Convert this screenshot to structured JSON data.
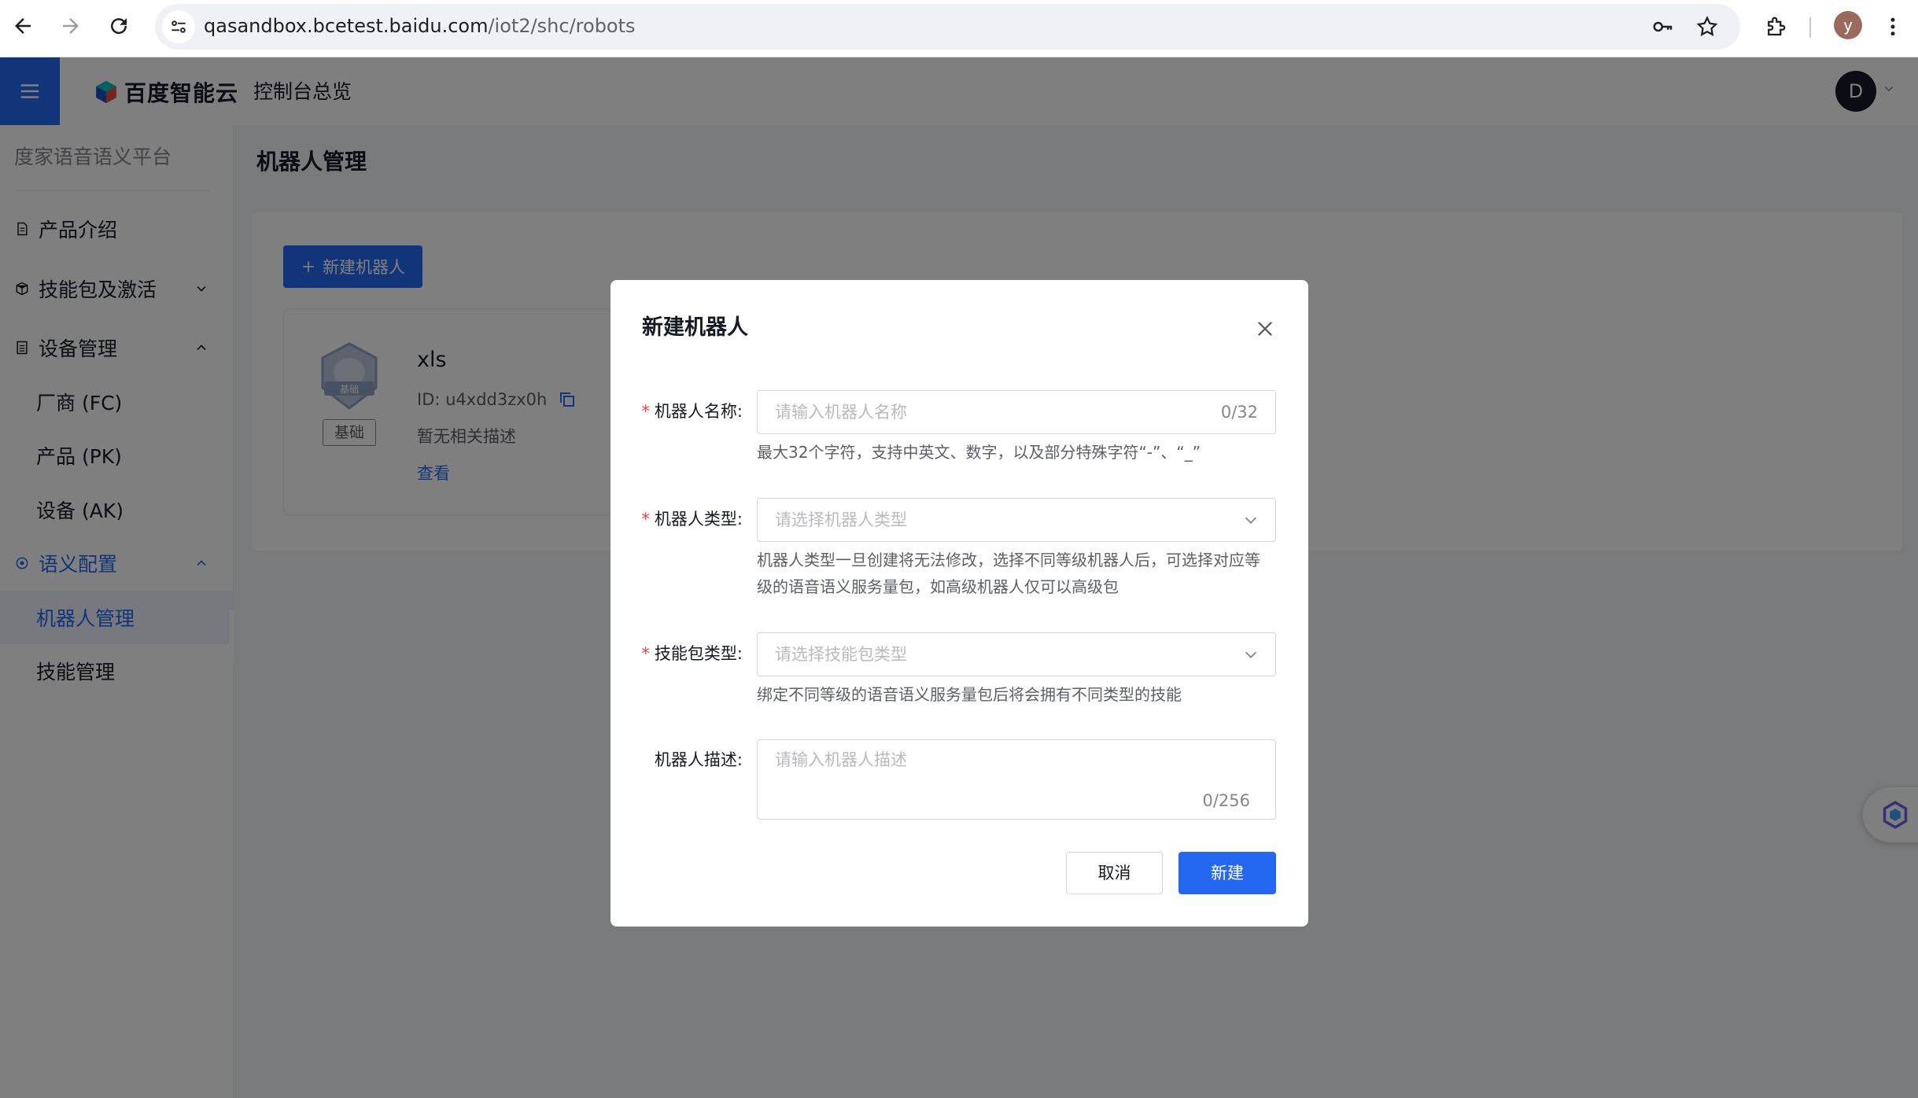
{
  "browser": {
    "url_host": "qasandbox.bcetest.baidu.com",
    "url_path": "/iot2/shc/robots",
    "profile_initial": "y"
  },
  "header": {
    "logo_text": "百度智能云",
    "console_link": "控制台总览",
    "user_initial": "D",
    "accent_color": "#2468f2"
  },
  "sidebar": {
    "title": "度家语音语义平台",
    "items": [
      {
        "label": "产品介绍",
        "icon": "document-icon"
      },
      {
        "label": "技能包及激活",
        "icon": "package-icon",
        "expanded": false
      },
      {
        "label": "设备管理",
        "icon": "device-icon",
        "expanded": true
      },
      {
        "label": "厂商 (FC)"
      },
      {
        "label": "产品 (PK)"
      },
      {
        "label": "设备 (AK)"
      },
      {
        "label": "语义配置",
        "icon": "target-icon",
        "expanded": true
      },
      {
        "label": "机器人管理",
        "active": true
      },
      {
        "label": "技能管理"
      }
    ]
  },
  "main": {
    "page_title": "机器人管理",
    "new_button": "新建机器人",
    "robot_card": {
      "level_tag": "基础",
      "badge_text": "基础",
      "name": "xls",
      "id_text": "ID:  u4xdd3zx0h",
      "description": "暂无相关描述",
      "view_link": "查看"
    }
  },
  "modal": {
    "title": "新建机器人",
    "fields": {
      "name": {
        "label": "机器人名称:",
        "required": true,
        "placeholder": "请输入机器人名称",
        "count": "0/32",
        "hint": "最大32个字符，支持中英文、数字，以及部分特殊字符“-”、“_”"
      },
      "type": {
        "label": "机器人类型:",
        "required": true,
        "placeholder": "请选择机器人类型",
        "hint_line1": "机器人类型一旦创建将无法修改，选择不同等级机器人后，可选择对应等",
        "hint_line2": "级的语音语义服务量包，如高级机器人仅可以高级包"
      },
      "skill": {
        "label": "技能包类型:",
        "required": true,
        "placeholder": "请选择技能包类型",
        "hint": "绑定不同等级的语音语义服务量包后将会拥有不同类型的技能"
      },
      "desc": {
        "label": "机器人描述:",
        "required": false,
        "placeholder": "请输入机器人描述",
        "count": "0/256"
      }
    },
    "cancel_label": "取消",
    "submit_label": "新建"
  }
}
